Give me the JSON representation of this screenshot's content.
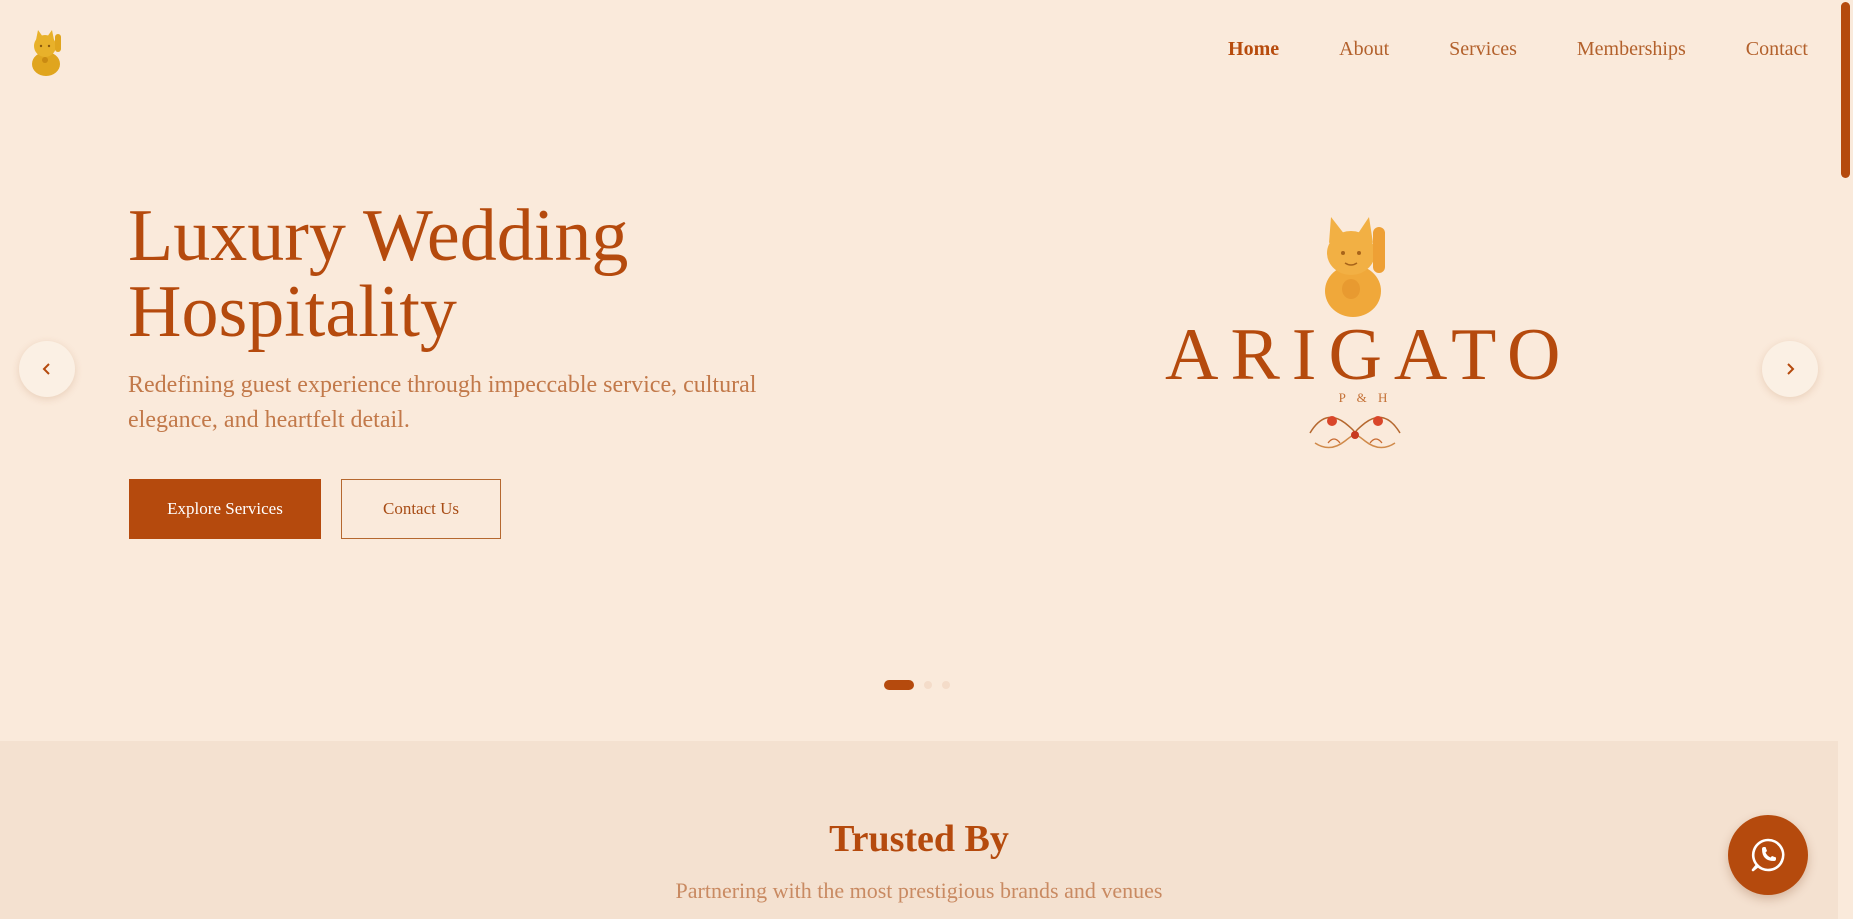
{
  "header": {
    "logo_name": "maneki-neko-logo",
    "nav": [
      {
        "label": "Home",
        "active": true
      },
      {
        "label": "About",
        "active": false
      },
      {
        "label": "Services",
        "active": false
      },
      {
        "label": "Memberships",
        "active": false
      },
      {
        "label": "Contact",
        "active": false
      }
    ]
  },
  "hero": {
    "title_line1": "Luxury Wedding",
    "title_line2": "Hospitality",
    "subtitle": "Redefining guest experience through impeccable service, cultural elegance, and heartfelt detail.",
    "primary_button": "Explore Services",
    "secondary_button": "Contact Us",
    "brand_word": "ARIGATO",
    "brand_sub": "P & H",
    "slide_count": 3,
    "active_slide": 1
  },
  "trusted": {
    "title": "Trusted By",
    "subtitle": "Partnering with the most prestigious brands and venues"
  },
  "colors": {
    "background": "#faeadb",
    "accent": "#b54a0d",
    "section_bg": "#f4e1d0",
    "muted_text": "#c2794a"
  },
  "icons": {
    "prev": "chevron-left-icon",
    "next": "chevron-right-icon",
    "whatsapp": "whatsapp-icon"
  }
}
